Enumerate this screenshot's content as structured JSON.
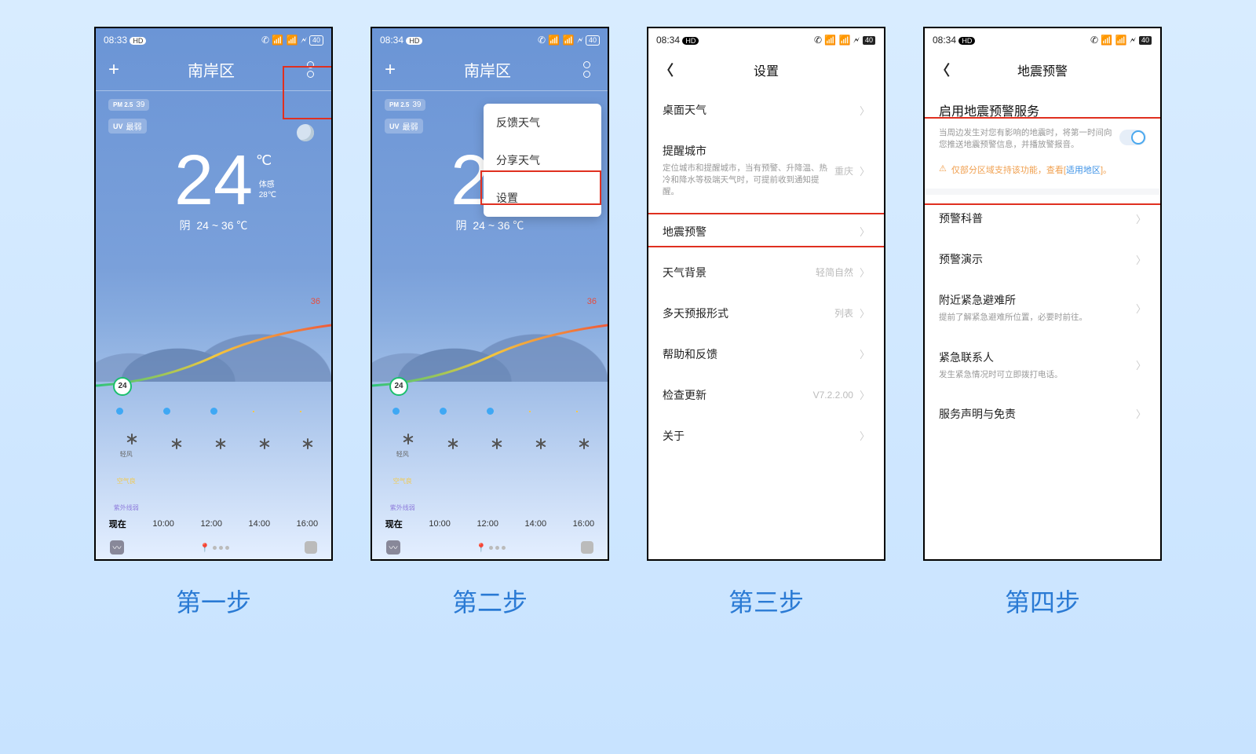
{
  "captions": [
    "第一步",
    "第二步",
    "第三步",
    "第四步"
  ],
  "status": {
    "t1": "08:33",
    "t2": "08:34",
    "hd": "HD",
    "batt": "40"
  },
  "weather": {
    "loc": "南岸区",
    "pm_label": "PM 2.5",
    "pm_val": "39",
    "uv_label": "UV",
    "uv_val": "最弱",
    "temp": "24",
    "unit": "℃",
    "feel_l": "体感",
    "feel_v": "28℃",
    "cond": "阴",
    "range": "24 ~ 36 ℃",
    "hi": "36",
    "lo": "24",
    "hours": [
      "现在",
      "10:00",
      "12:00",
      "14:00",
      "16:00"
    ],
    "fan": "轻风",
    "leaf": "空气良",
    "hat": "紫外线弱"
  },
  "menu": {
    "i1": "反馈天气",
    "i2": "分享天气",
    "i3": "设置"
  },
  "settings": {
    "title": "设置",
    "r1": "桌面天气",
    "r2": "提醒城市",
    "r2_sub": "定位城市和提醒城市，当有预警、升降温、热冷和降水等极端天气时，可提前收到通知提醒。",
    "r2_v": "重庆",
    "r3": "地震预警",
    "r4": "天气背景",
    "r4_v": "轻简自然",
    "r5": "多天预报形式",
    "r5_v": "列表",
    "r6": "帮助和反馈",
    "r7": "检查更新",
    "r7_v": "V7.2.2.00",
    "r8": "关于"
  },
  "quake": {
    "title": "地震预警",
    "sw_title": "启用地震预警服务",
    "sw_sub": "当周边发生对您有影响的地震时，将第一时间向您推送地震预警信息，并播放警报音。",
    "warn_pre": "仅部分区域支持该功能，查看[",
    "warn_link": "适用地区",
    "warn_post": "]。",
    "r1": "预警科普",
    "r2": "预警演示",
    "r3": "附近紧急避难所",
    "r3_sub": "提前了解紧急避难所位置，必要时前往。",
    "r4": "紧急联系人",
    "r4_sub": "发生紧急情况时可立即拨打电话。",
    "r5": "服务声明与免责"
  }
}
